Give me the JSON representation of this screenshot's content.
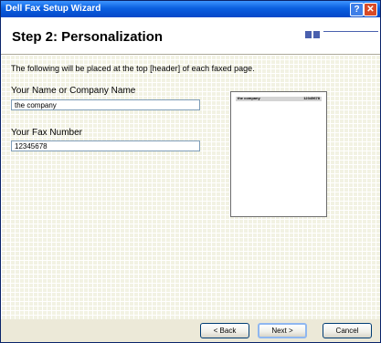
{
  "window": {
    "title": "Dell Fax Setup Wizard",
    "help_glyph": "?",
    "close_glyph": "✕"
  },
  "header": {
    "step_title": "Step 2: Personalization"
  },
  "content": {
    "instruction": "The following will be placed at the top [header] of each faxed page.",
    "name_label": "Your Name or Company Name",
    "name_value": "the company",
    "fax_label": "Your Fax Number",
    "fax_value": "12345678"
  },
  "preview": {
    "name": "the company",
    "fax": "12345678"
  },
  "buttons": {
    "back": "< Back",
    "next": "Next >",
    "cancel": "Cancel"
  },
  "colors": {
    "title_bar": "#0a5fe0",
    "progress_accent": "#4a60ae",
    "content_bg": "#f2f2e3"
  }
}
